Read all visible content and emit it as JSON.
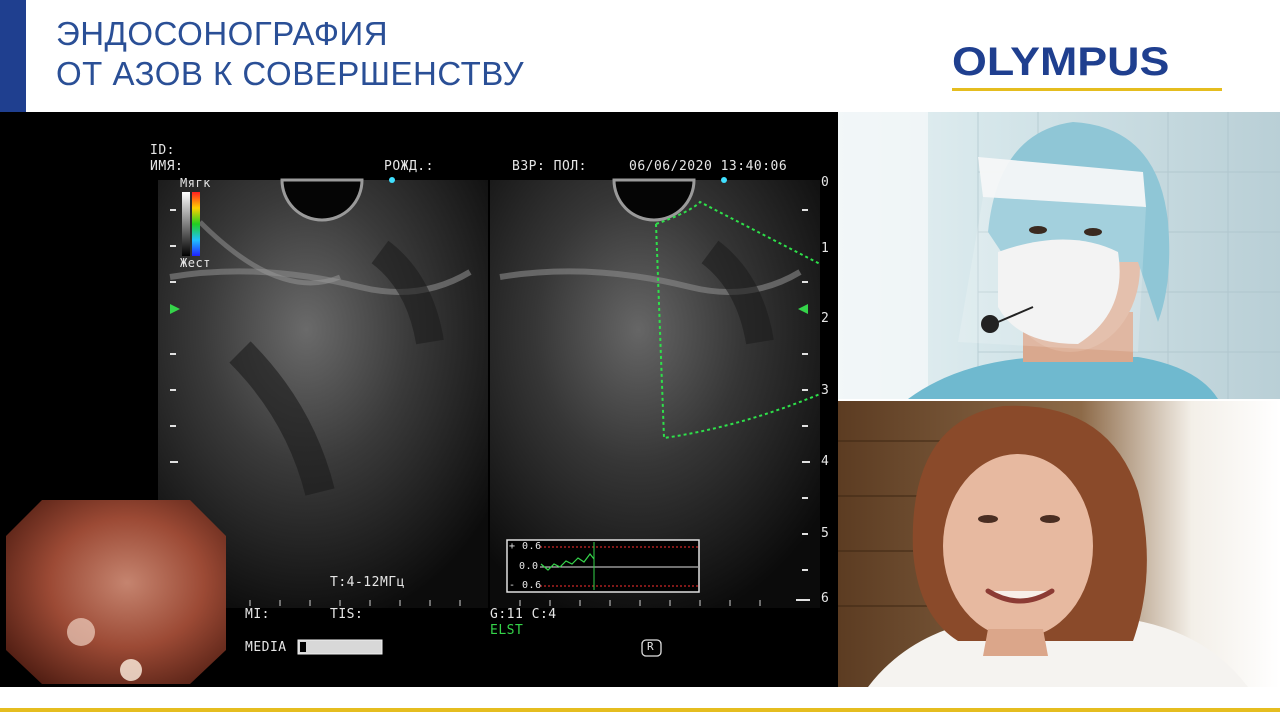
{
  "colors": {
    "accent_blue": "#1f3f8f",
    "title_blue": "#2a4f96",
    "brand_yellow": "#e5bd1f",
    "elst_green": "#35d44a"
  },
  "header": {
    "title_line1": "ЭНДОСОНОГРАФИЯ",
    "title_line2": "ОТ АЗОВ К СОВЕРШЕНСТВУ",
    "brand": "OLYMPUS"
  },
  "ultrasound": {
    "id_label": "ID:",
    "name_label": "ИМЯ:",
    "dob_label": "РОЖД.:",
    "age_sex_label": "ВЗР: ПОЛ:",
    "datetime": "06/06/2020 13:40:06",
    "scale_soft": "Мягк",
    "scale_hard": "Жест",
    "depth_ticks": [
      "0",
      "1",
      "2",
      "3",
      "4",
      "5",
      "6"
    ],
    "frequency": "T:4-12МГц",
    "mi_label": "MI:",
    "tis_label": "TIS:",
    "gain": "G:11 C:4",
    "mode": "ELST",
    "media_label": "MEDIA",
    "graph_labels": [
      "+ 0.6",
      "0.0",
      "- 0.6"
    ],
    "registered_mark": "R"
  },
  "icons": {
    "color_scale": "elastography-color-scale-icon",
    "focus_marker": "focus-marker-icon",
    "registered": "registered-mark-icon"
  }
}
